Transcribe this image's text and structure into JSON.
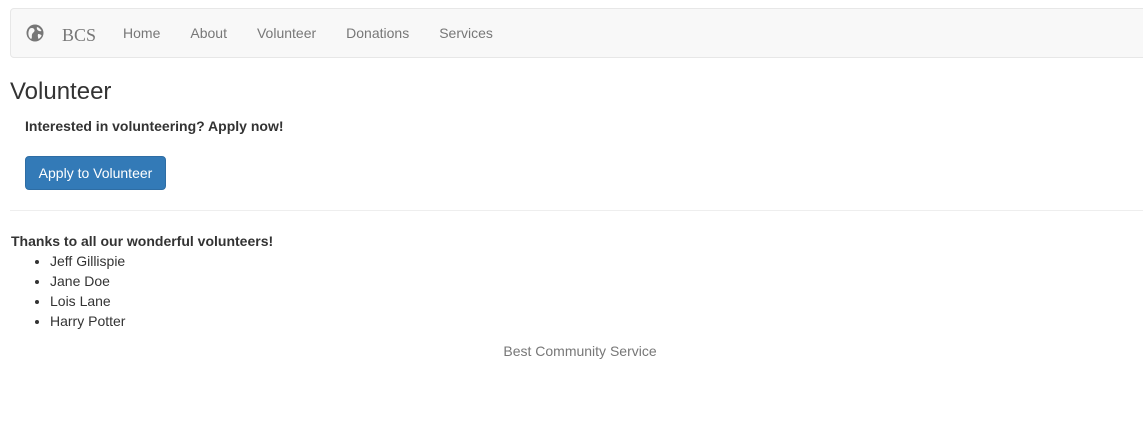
{
  "navbar": {
    "brand_icon": "globe-icon",
    "brand": "BCS",
    "links": [
      "Home",
      "About",
      "Volunteer",
      "Donations",
      "Services"
    ]
  },
  "main": {
    "title": "Volunteer",
    "lead": "Interested in volunteering? Apply now!",
    "apply_button": "Apply to Volunteer",
    "thanks_heading": "Thanks to all our wonderful volunteers!",
    "volunteers": [
      "Jeff Gillispie",
      "Jane Doe",
      "Lois Lane",
      "Harry Potter"
    ]
  },
  "footer": {
    "text": "Best Community Service"
  },
  "colors": {
    "primary": "#337ab7",
    "navbar_bg": "#f8f8f8",
    "muted_text": "#777777"
  }
}
